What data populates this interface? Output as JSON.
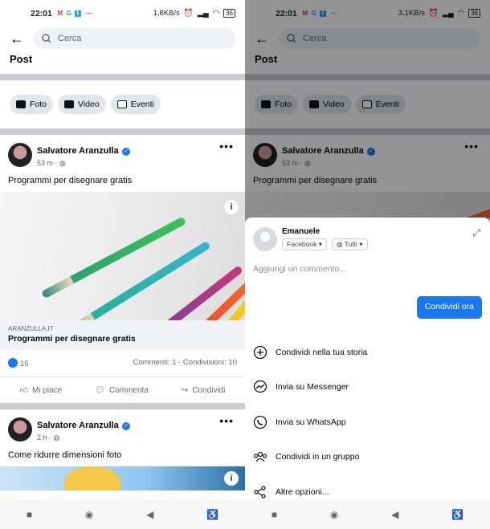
{
  "left": {
    "status": {
      "time": "22:01",
      "apps": [
        "M",
        "G",
        "t"
      ],
      "more": "···",
      "speed": "1,8KB/s",
      "battery": "36"
    },
    "search_placeholder": "Cerca",
    "section_title": "Post",
    "chips": [
      "Foto",
      "Video",
      "Eventi"
    ],
    "post1": {
      "author": "Salvatore Aranzulla",
      "time": "53 m ·",
      "text": "Programmi per disegnare gratis",
      "link_domain": "ARANZULLA.IT",
      "link_title": "Programmi per disegnare gratis",
      "likes": "15",
      "counts": "Commenti: 1 · Condivisioni: 10",
      "actions": [
        "Mi piace",
        "Commenta",
        "Condividi"
      ]
    },
    "post2": {
      "author": "Salvatore Aranzulla",
      "time": "2 h ·",
      "text": "Come ridurre dimensioni foto"
    }
  },
  "right": {
    "status": {
      "time": "22:01",
      "apps": [
        "M",
        "G",
        "t"
      ],
      "more": "···",
      "speed": "3,1KB/s",
      "battery": "36"
    },
    "share_sheet": {
      "user": "Emanuele",
      "audience": "Facebook",
      "privacy": "Tutti",
      "comment_placeholder": "Aggiungi un commento...",
      "share_now": "Condividi ora",
      "options": [
        {
          "icon": "plus-circle-icon",
          "label": "Condividi nella tua storia"
        },
        {
          "icon": "messenger-icon",
          "label": "Invia su Messenger"
        },
        {
          "icon": "whatsapp-icon",
          "label": "Invia su WhatsApp"
        },
        {
          "icon": "group-icon",
          "label": "Condividi in un gruppo"
        },
        {
          "icon": "share-icon",
          "label": "Altre opzioni..."
        }
      ]
    }
  },
  "nav": {
    "buttons": [
      "■",
      "◉",
      "◀",
      "♿"
    ]
  }
}
